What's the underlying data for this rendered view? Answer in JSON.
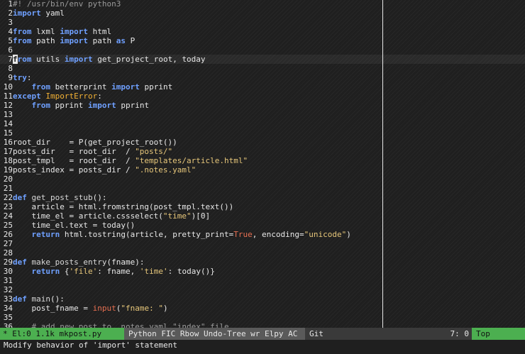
{
  "editor": {
    "lines": [
      {
        "n": "1",
        "spans": [
          {
            "t": "#! /usr/bin/env python3",
            "c": "cm"
          }
        ]
      },
      {
        "n": "2",
        "spans": [
          {
            "t": "import",
            "c": "kw"
          },
          {
            "t": " yaml",
            "c": ""
          }
        ]
      },
      {
        "n": "3",
        "spans": []
      },
      {
        "n": "4",
        "spans": [
          {
            "t": "from",
            "c": "kw"
          },
          {
            "t": " lxml ",
            "c": ""
          },
          {
            "t": "import",
            "c": "kw"
          },
          {
            "t": " html",
            "c": ""
          }
        ]
      },
      {
        "n": "5",
        "spans": [
          {
            "t": "from",
            "c": "kw"
          },
          {
            "t": " path ",
            "c": ""
          },
          {
            "t": "import",
            "c": "kw"
          },
          {
            "t": " path ",
            "c": ""
          },
          {
            "t": "as",
            "c": "kw"
          },
          {
            "t": " P",
            "c": ""
          }
        ]
      },
      {
        "n": "6",
        "spans": []
      },
      {
        "n": "7",
        "current": true,
        "spans": [
          {
            "t": "f",
            "c": "kw cursor"
          },
          {
            "t": "rom",
            "c": "kw"
          },
          {
            "t": " utils ",
            "c": ""
          },
          {
            "t": "import",
            "c": "kw"
          },
          {
            "t": " get_project_root, today",
            "c": ""
          }
        ]
      },
      {
        "n": "8",
        "spans": []
      },
      {
        "n": "9",
        "spans": [
          {
            "t": "try",
            "c": "kw"
          },
          {
            "t": ":",
            "c": ""
          }
        ]
      },
      {
        "n": "10",
        "spans": [
          {
            "t": "    ",
            "c": ""
          },
          {
            "t": "from",
            "c": "kw"
          },
          {
            "t": " betterprint ",
            "c": ""
          },
          {
            "t": "import",
            "c": "kw"
          },
          {
            "t": " pprint",
            "c": ""
          }
        ]
      },
      {
        "n": "11",
        "spans": [
          {
            "t": "except",
            "c": "kw"
          },
          {
            "t": " ",
            "c": ""
          },
          {
            "t": "ImportError",
            "c": "exc"
          },
          {
            "t": ":",
            "c": ""
          }
        ]
      },
      {
        "n": "12",
        "spans": [
          {
            "t": "    ",
            "c": ""
          },
          {
            "t": "from",
            "c": "kw"
          },
          {
            "t": " pprint ",
            "c": ""
          },
          {
            "t": "import",
            "c": "kw"
          },
          {
            "t": " pprint",
            "c": ""
          }
        ]
      },
      {
        "n": "13",
        "spans": []
      },
      {
        "n": "14",
        "spans": []
      },
      {
        "n": "15",
        "spans": []
      },
      {
        "n": "16",
        "spans": [
          {
            "t": "root_dir    = P(get_project_root())",
            "c": ""
          }
        ]
      },
      {
        "n": "17",
        "spans": [
          {
            "t": "posts_dir   = root_dir  / ",
            "c": ""
          },
          {
            "t": "\"posts/\"",
            "c": "str"
          }
        ]
      },
      {
        "n": "18",
        "spans": [
          {
            "t": "post_tmpl   = root_dir  / ",
            "c": ""
          },
          {
            "t": "\"templates/article.html\"",
            "c": "str"
          }
        ]
      },
      {
        "n": "19",
        "spans": [
          {
            "t": "posts_index = posts_dir / ",
            "c": ""
          },
          {
            "t": "\".notes.yaml\"",
            "c": "str"
          }
        ]
      },
      {
        "n": "20",
        "spans": []
      },
      {
        "n": "21",
        "spans": []
      },
      {
        "n": "22",
        "spans": [
          {
            "t": "def",
            "c": "kw"
          },
          {
            "t": " get_post_stub",
            "c": "fn"
          },
          {
            "t": "():",
            "c": ""
          }
        ]
      },
      {
        "n": "23",
        "spans": [
          {
            "t": "    article = html.fromstring(post_tmpl.text())",
            "c": ""
          }
        ]
      },
      {
        "n": "24",
        "spans": [
          {
            "t": "    time_el = article.cssselect(",
            "c": ""
          },
          {
            "t": "\"time\"",
            "c": "str"
          },
          {
            "t": ")[0]",
            "c": ""
          }
        ]
      },
      {
        "n": "25",
        "spans": [
          {
            "t": "    time_el.text = today()",
            "c": ""
          }
        ]
      },
      {
        "n": "26",
        "spans": [
          {
            "t": "    ",
            "c": ""
          },
          {
            "t": "return",
            "c": "kw"
          },
          {
            "t": " html.tostring(article, pretty_print=",
            "c": ""
          },
          {
            "t": "True",
            "c": "con"
          },
          {
            "t": ", encoding=",
            "c": ""
          },
          {
            "t": "\"unicode\"",
            "c": "str"
          },
          {
            "t": ")",
            "c": ""
          }
        ]
      },
      {
        "n": "27",
        "spans": []
      },
      {
        "n": "28",
        "spans": []
      },
      {
        "n": "29",
        "spans": [
          {
            "t": "def",
            "c": "kw"
          },
          {
            "t": " make_posts_entry",
            "c": "fn"
          },
          {
            "t": "(fname):",
            "c": ""
          }
        ]
      },
      {
        "n": "30",
        "spans": [
          {
            "t": "    ",
            "c": ""
          },
          {
            "t": "return",
            "c": "kw"
          },
          {
            "t": " {",
            "c": ""
          },
          {
            "t": "'file'",
            "c": "str"
          },
          {
            "t": ": fname, ",
            "c": ""
          },
          {
            "t": "'time'",
            "c": "str"
          },
          {
            "t": ": today()}",
            "c": ""
          }
        ]
      },
      {
        "n": "31",
        "spans": []
      },
      {
        "n": "32",
        "spans": []
      },
      {
        "n": "33",
        "spans": [
          {
            "t": "def",
            "c": "kw"
          },
          {
            "t": " main",
            "c": "fn"
          },
          {
            "t": "():",
            "c": ""
          }
        ]
      },
      {
        "n": "34",
        "spans": [
          {
            "t": "    post_fname = ",
            "c": ""
          },
          {
            "t": "input",
            "c": "con"
          },
          {
            "t": "(",
            "c": ""
          },
          {
            "t": "\"fname: \"",
            "c": "str"
          },
          {
            "t": ")",
            "c": ""
          }
        ]
      },
      {
        "n": "35",
        "spans": []
      },
      {
        "n": "36",
        "spans": [
          {
            "t": "    ",
            "c": ""
          },
          {
            "t": "# add new post to .notes.yaml \"index\" file",
            "c": "cm"
          }
        ]
      }
    ]
  },
  "modeline": {
    "state": "* El:0 1.1k mkpost.py",
    "modes": "Python FIC Rbow Undo-Tree wr Elpy AC",
    "vc": "Git",
    "line": "7",
    "sep": ":",
    "column": "0",
    "position": "Top"
  },
  "echo_area": {
    "message": "Modify behavior of 'import' statement"
  },
  "colors": {
    "background": "#1f1f1f",
    "keyword": "#6fa0ff",
    "string": "#e6c67a",
    "constant": "#e76f51",
    "modeline_accent": "#4caf50"
  }
}
